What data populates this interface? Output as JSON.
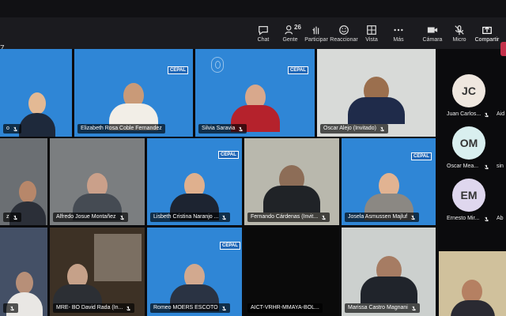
{
  "meeting": {
    "time": "7"
  },
  "toolbar": {
    "items": [
      {
        "label": "Chat",
        "icon": "chat-icon"
      },
      {
        "label": "Gente",
        "count": "26",
        "icon": "people-icon"
      },
      {
        "label": "Participar",
        "icon": "raise-hand-icon"
      },
      {
        "label": "Reaccionar",
        "icon": "emoji-icon"
      },
      {
        "label": "Vista",
        "icon": "grid-icon"
      },
      {
        "label": "Más",
        "icon": "more-icon"
      },
      {
        "label": "Cámara",
        "icon": "camera-icon"
      },
      {
        "label": "Micro",
        "icon": "mic-off-icon"
      },
      {
        "label": "Compartir",
        "icon": "share-icon"
      }
    ]
  },
  "tiles": [
    {
      "name": "o"
    },
    {
      "name": "Elizabeth Rosa Coble Fernandez"
    },
    {
      "name": "Silvia Saravia"
    },
    {
      "name": "Oscar Alejo (Invitado)"
    },
    {
      "name": "z"
    },
    {
      "name": "Alfredo Josue Montañez"
    },
    {
      "name": "Lisbeth Cristina Naranjo ..."
    },
    {
      "name": "Fernando Cárdenas (Invit..."
    },
    {
      "name": "Josela Asmussen Majluf"
    },
    {
      "name": ""
    },
    {
      "name": "MRE- BO David Rada (In..."
    },
    {
      "name": "Romeo MOERS ESCOTO"
    },
    {
      "name": "AICT-VRHR-MMAYA-BOL..."
    },
    {
      "name": "Marissa Castro Magnani"
    }
  ],
  "sidebar": {
    "participants": [
      {
        "initials": "JC",
        "name": "Juan Carlos...",
        "color": "#efe7df"
      },
      {
        "initials": "OM",
        "name": "Oscar Mea...",
        "color": "#d9efef"
      },
      {
        "initials": "EM",
        "name": "Ernesto Mir...",
        "color": "#dfd7ee"
      }
    ],
    "edge_names": [
      "Aid",
      "sin",
      "Ab"
    ]
  },
  "colors": {
    "un_blue": "#2f86d6",
    "toolbar": "#1b1b1f",
    "leave": "#c4314b"
  }
}
